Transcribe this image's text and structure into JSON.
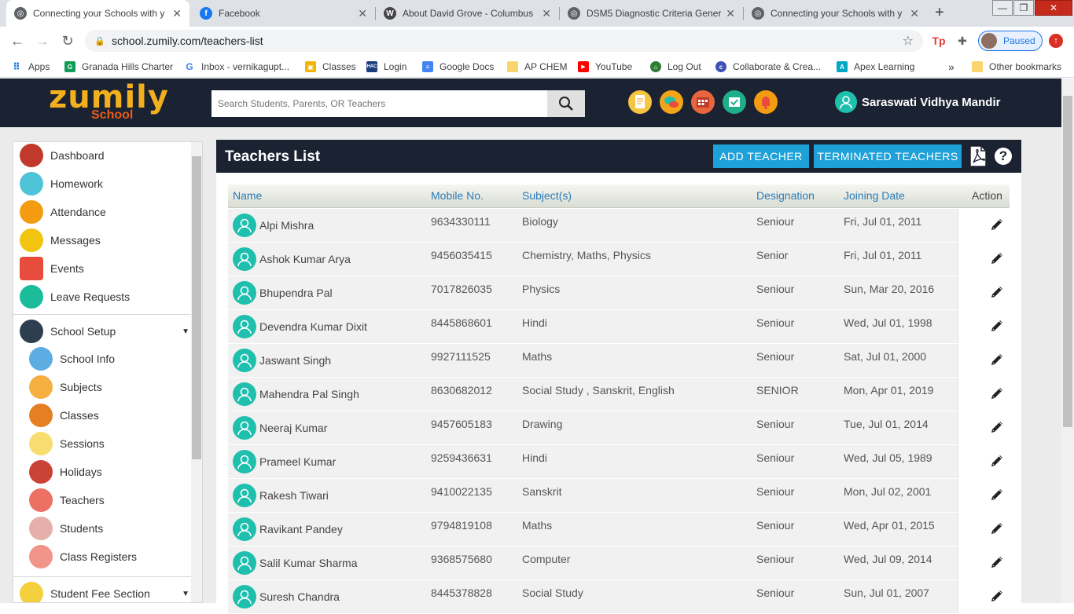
{
  "browser": {
    "tabs": [
      {
        "title": "Connecting your Schools with y",
        "favicon": "globe-icon",
        "active": true
      },
      {
        "title": "Facebook",
        "favicon": "facebook-icon",
        "active": false
      },
      {
        "title": "About David Grove - Columbus",
        "favicon": "wordpress-icon",
        "active": false
      },
      {
        "title": "DSM5 Diagnostic Criteria Gener",
        "favicon": "globe-icon",
        "active": false
      },
      {
        "title": "Connecting your Schools with y",
        "favicon": "globe-icon",
        "active": false
      }
    ],
    "url": "school.zumily.com/teachers-list",
    "profile_status": "Paused",
    "bookmarks": [
      {
        "label": "Apps",
        "icon": "apps-grid-icon"
      },
      {
        "label": "Granada Hills Charter",
        "icon": "g-icon"
      },
      {
        "label": "Inbox - vernikagupt...",
        "icon": "google-icon"
      },
      {
        "label": "Classes",
        "icon": "classroom-icon"
      },
      {
        "label": "Login",
        "icon": "hac-icon"
      },
      {
        "label": "Google Docs",
        "icon": "docs-icon"
      },
      {
        "label": "AP CHEM",
        "icon": "folder-icon"
      },
      {
        "label": "YouTube",
        "icon": "youtube-icon"
      },
      {
        "label": "Log Out",
        "icon": "logout-icon"
      },
      {
        "label": "Collaborate & Crea...",
        "icon": "c-icon"
      },
      {
        "label": "Apex Learning",
        "icon": "apex-icon"
      },
      {
        "label": "Other bookmarks",
        "icon": "folder-icon"
      }
    ],
    "bookmarks_overflow": "»"
  },
  "site": {
    "logo_main": "zumily",
    "logo_sub": "School",
    "search_placeholder": "Search Students, Parents, OR Teachers",
    "school_name": "Saraswati Vidhya Mandir"
  },
  "sidebar": {
    "items": [
      {
        "label": "Dashboard",
        "icon": "dashboard-icon",
        "color": "#c0392b"
      },
      {
        "label": "Homework",
        "icon": "homework-icon",
        "color": "#4fc3d8"
      },
      {
        "label": "Attendance",
        "icon": "attendance-icon",
        "color": "#f39c12"
      },
      {
        "label": "Messages",
        "icon": "messages-icon",
        "color": "#f1c40f"
      },
      {
        "label": "Events",
        "icon": "events-icon",
        "color": "#e74c3c"
      },
      {
        "label": "Leave Requests",
        "icon": "leave-requests-icon",
        "color": "#1abc9c"
      }
    ],
    "school_setup": {
      "label": "School Setup",
      "items": [
        {
          "label": "School Info",
          "icon": "school-info-icon",
          "color": "#5dade2"
        },
        {
          "label": "Subjects",
          "icon": "subjects-icon",
          "color": "#f5b041"
        },
        {
          "label": "Classes",
          "icon": "classes-icon",
          "color": "#e67e22"
        },
        {
          "label": "Sessions",
          "icon": "sessions-icon",
          "color": "#f7dc6f"
        },
        {
          "label": "Holidays",
          "icon": "holidays-icon",
          "color": "#cb4335"
        },
        {
          "label": "Teachers",
          "icon": "teachers-icon",
          "color": "#ec7063"
        },
        {
          "label": "Students",
          "icon": "students-icon",
          "color": "#e6b0aa"
        },
        {
          "label": "Class Registers",
          "icon": "class-registers-icon",
          "color": "#f1948a"
        }
      ]
    },
    "student_fee": {
      "label": "Student Fee Section",
      "icon": "fee-icon",
      "color": "#f4d03f"
    }
  },
  "panel": {
    "title": "Teachers List",
    "add_button": "ADD TEACHER",
    "terminated_button": "TERMINATED TEACHERS",
    "help": "?",
    "columns": {
      "name": "Name",
      "mobile": "Mobile No.",
      "subjects": "Subject(s)",
      "designation": "Designation",
      "joining": "Joining Date",
      "action": "Action"
    },
    "rows": [
      {
        "name": "Alpi Mishra",
        "mobile": "9634330111",
        "subjects": "Biology",
        "designation": "Seniour",
        "joining": "Fri, Jul 01, 2011"
      },
      {
        "name": "Ashok Kumar Arya",
        "mobile": "9456035415",
        "subjects": "Chemistry, Maths, Physics",
        "designation": "Senior",
        "joining": "Fri, Jul 01, 2011"
      },
      {
        "name": "Bhupendra Pal",
        "mobile": "7017826035",
        "subjects": "Physics",
        "designation": "Seniour",
        "joining": "Sun, Mar 20, 2016"
      },
      {
        "name": "Devendra Kumar Dixit",
        "mobile": "8445868601",
        "subjects": "Hindi",
        "designation": "Seniour",
        "joining": "Wed, Jul 01, 1998"
      },
      {
        "name": "Jaswant Singh",
        "mobile": "9927111525",
        "subjects": "Maths",
        "designation": "Seniour",
        "joining": "Sat, Jul 01, 2000"
      },
      {
        "name": "Mahendra Pal Singh",
        "mobile": "8630682012",
        "subjects": "Social Study , Sanskrit, English",
        "designation": "SENIOR",
        "joining": "Mon, Apr 01, 2019"
      },
      {
        "name": "Neeraj Kumar",
        "mobile": "9457605183",
        "subjects": "Drawing",
        "designation": "Seniour",
        "joining": "Tue, Jul 01, 2014"
      },
      {
        "name": "Prameel Kumar",
        "mobile": "9259436631",
        "subjects": "Hindi",
        "designation": "Seniour",
        "joining": "Wed, Jul 05, 1989"
      },
      {
        "name": "Rakesh Tiwari",
        "mobile": "9410022135",
        "subjects": "Sanskrit",
        "designation": "Seniour",
        "joining": "Mon, Jul 02, 2001"
      },
      {
        "name": "Ravikant Pandey",
        "mobile": "9794819108",
        "subjects": "Maths",
        "designation": "Seniour",
        "joining": "Wed, Apr 01, 2015"
      },
      {
        "name": "Salil Kumar Sharma",
        "mobile": "9368575680",
        "subjects": "Computer",
        "designation": "Seniour",
        "joining": "Wed, Jul 09, 2014"
      },
      {
        "name": "Suresh Chandra",
        "mobile": "8445378828",
        "subjects": "Social Study",
        "designation": "Seniour",
        "joining": "Sun, Jul 01, 2007"
      }
    ]
  },
  "colors": {
    "header_bg": "#1b2231",
    "accent_button": "#1ea1d8",
    "avatar": "#1fbfae",
    "column_header_text": "#2a7ab8",
    "logo_yellow": "#f2b01e",
    "logo_orange": "#e85c1c"
  }
}
